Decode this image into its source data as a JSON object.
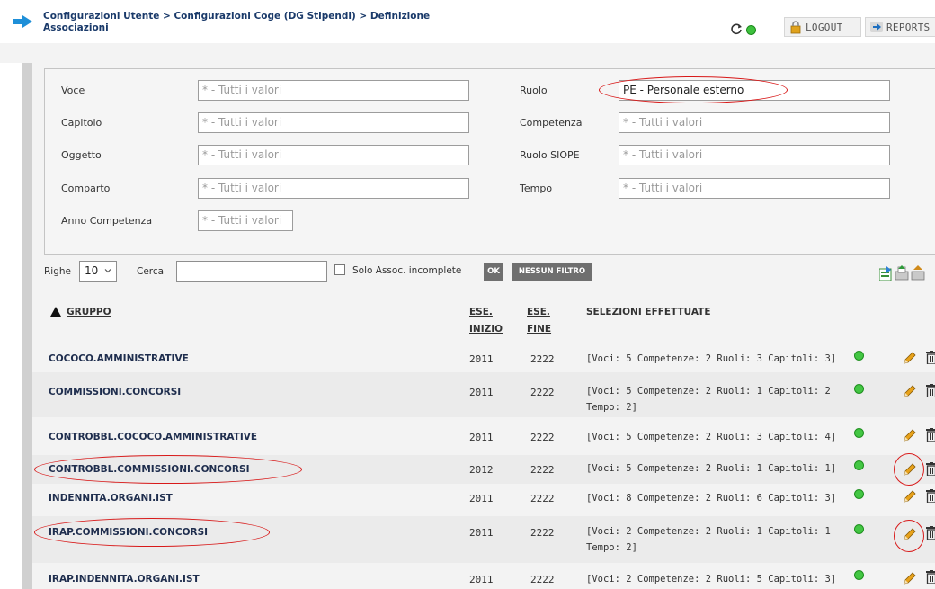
{
  "header": {
    "breadcrumb": "Configurazioni Utente > Configurazioni Coge (DG Stipendi) > Definizione Associazioni",
    "logout_label": "LOGOUT",
    "reports_label": "REPORTS"
  },
  "filters": {
    "voce": {
      "label": "Voce",
      "value": "* - Tutti i valori"
    },
    "capitolo": {
      "label": "Capitolo",
      "value": "* - Tutti i valori"
    },
    "oggetto": {
      "label": "Oggetto",
      "value": "* - Tutti i valori"
    },
    "comparto": {
      "label": "Comparto",
      "value": "* - Tutti i valori"
    },
    "anno_competenza": {
      "label": "Anno Competenza",
      "value": "* - Tutti i valori"
    },
    "ruolo": {
      "label": "Ruolo",
      "value": "PE - Personale esterno"
    },
    "competenza": {
      "label": "Competenza",
      "value": "* - Tutti i valori"
    },
    "ruolo_siope": {
      "label": "Ruolo SIOPE",
      "value": "* - Tutti i valori"
    },
    "tempo": {
      "label": "Tempo",
      "value": "* - Tutti i valori"
    }
  },
  "toolbar": {
    "righe_label": "Righe",
    "righe_value": "10",
    "cerca_label": "Cerca",
    "search_value": "",
    "incomplete_label": "Solo Assoc. incomplete",
    "ok_label": "OK",
    "nofilter_label": "NESSUN FILTRO"
  },
  "table": {
    "columns": {
      "gruppo": "GRUPPO",
      "ese_inizio_1": "ESE.",
      "ese_inizio_2": "INIZIO",
      "ese_fine_1": "ESE.",
      "ese_fine_2": "FINE",
      "selezioni": "SELEZIONI EFFETTUATE"
    },
    "rows": [
      {
        "gruppo": "COCOCO.AMMINISTRATIVE",
        "inizio": "2011",
        "fine": "2222",
        "sel1": "[Voci: 5 Competenze: 2 Ruoli: 3 Capitoli: 3]",
        "sel2": ""
      },
      {
        "gruppo": "COMMISSIONI.CONCORSI",
        "inizio": "2011",
        "fine": "2222",
        "sel1": "[Voci: 5 Competenze: 2 Ruoli: 1 Capitoli: 2",
        "sel2": "Tempo: 2]"
      },
      {
        "gruppo": "CONTROBBL.COCOCO.AMMINISTRATIVE",
        "inizio": "2011",
        "fine": "2222",
        "sel1": "[Voci: 5 Competenze: 2 Ruoli: 3 Capitoli: 4]",
        "sel2": ""
      },
      {
        "gruppo": "CONTROBBL.COMMISSIONI.CONCORSI",
        "inizio": "2012",
        "fine": "2222",
        "sel1": "[Voci: 5 Competenze: 2 Ruoli: 1 Capitoli: 1]",
        "sel2": ""
      },
      {
        "gruppo": "INDENNITA.ORGANI.IST",
        "inizio": "2011",
        "fine": "2222",
        "sel1": "[Voci: 8 Competenze: 2 Ruoli: 6 Capitoli: 3]",
        "sel2": ""
      },
      {
        "gruppo": "IRAP.COMMISSIONI.CONCORSI",
        "inizio": "2011",
        "fine": "2222",
        "sel1": "[Voci: 2 Competenze: 2 Ruoli: 1 Capitoli: 1",
        "sel2": "Tempo: 2]"
      },
      {
        "gruppo": "IRAP.INDENNITA.ORGANI.IST",
        "inizio": "2011",
        "fine": "2222",
        "sel1": "[Voci: 2 Competenze: 2 Ruoli: 5 Capitoli: 3]",
        "sel2": ""
      }
    ]
  },
  "colors": {
    "status_green": "#43c643",
    "highlight_ring": "#d81919",
    "pencil": "#e8a21a"
  }
}
